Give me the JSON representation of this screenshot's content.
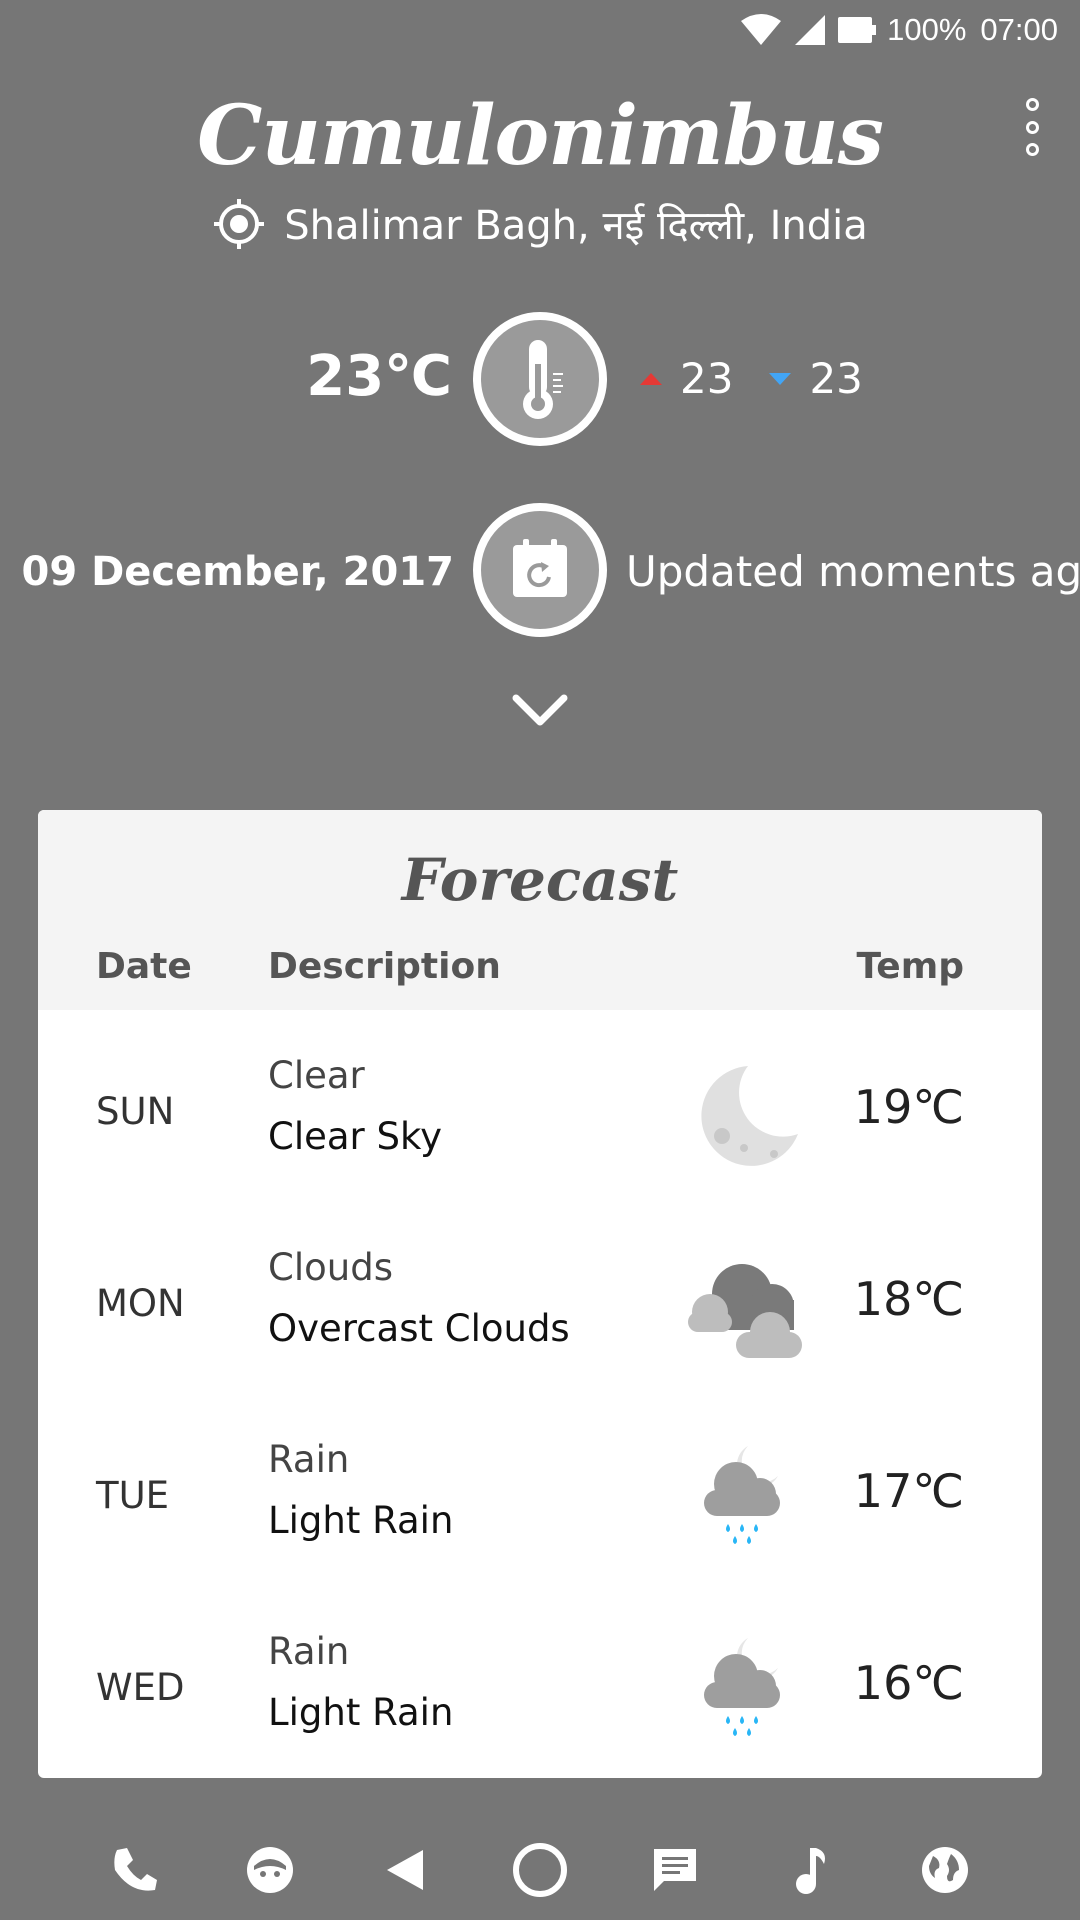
{
  "status_bar": {
    "battery": "100%",
    "time": "07:00"
  },
  "header": {
    "app_title": "Cumulonimbus",
    "location": "Shalimar Bagh, नई दिल्ली, India"
  },
  "current": {
    "temperature": "23℃",
    "high": "23",
    "low": "23",
    "date": "09 December, 2017",
    "updated": "Updated moments ago"
  },
  "forecast": {
    "title": "Forecast",
    "columns": {
      "date": "Date",
      "description": "Description",
      "temp": "Temp"
    },
    "rows": [
      {
        "day": "SUN",
        "main": "Clear",
        "desc": "Clear Sky",
        "temp": "19℃",
        "icon": "moon-icon"
      },
      {
        "day": "MON",
        "main": "Clouds",
        "desc": "Overcast Clouds",
        "temp": "18℃",
        "icon": "clouds-icon"
      },
      {
        "day": "TUE",
        "main": "Rain",
        "desc": "Light Rain",
        "temp": "17℃",
        "icon": "night-rain-icon"
      },
      {
        "day": "WED",
        "main": "Rain",
        "desc": "Light Rain",
        "temp": "16℃",
        "icon": "night-rain-icon"
      }
    ]
  },
  "colors": {
    "background": "#767676",
    "card": "#ffffff",
    "card_header": "#f4f4f4",
    "high_arrow": "#e53935",
    "low_arrow": "#42a5f5",
    "rain_drops": "#29b6f6"
  },
  "nav_icons": [
    "phone-icon",
    "messenger-face-icon",
    "back-icon",
    "home-icon",
    "messages-icon",
    "music-icon",
    "browser-globe-icon"
  ]
}
